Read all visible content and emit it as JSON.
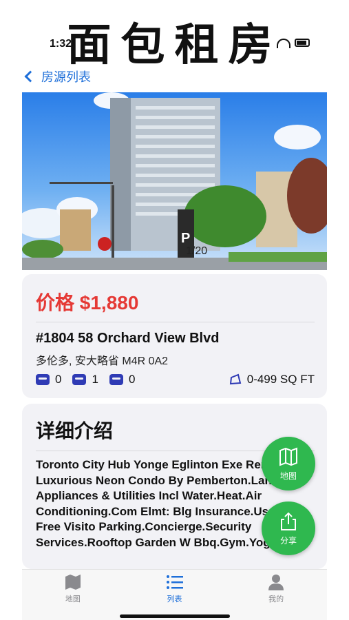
{
  "banner": {
    "title": "面包租房"
  },
  "status": {
    "time": "1:32"
  },
  "nav": {
    "back_label": "房源列表"
  },
  "photo": {
    "counter": "1/20"
  },
  "listing": {
    "price": "价格 $1,880",
    "address": "#1804  58 Orchard View Blvd",
    "region": "多伦多, 安大略省   M4R 0A2",
    "bedrooms": "0",
    "bathrooms": "1",
    "parking": "0",
    "area": "0-499  SQ FT"
  },
  "details": {
    "title": "详细介绍",
    "text": "Toronto City Hub Yonge Eglinton Exe Rental. Luxurious Neon Condo By Pemberton.Landlord Appliances & Utilities Incl Water.Heat.Air Conditioning.Com Elmt: Blg Insurance.Use Of Free Visito Parking.Concierge.Security Services.Rooftop Garden W Bbq.Gym.Yoga"
  },
  "fabs": {
    "map_label": "地图",
    "share_label": "分享"
  },
  "tabs": [
    {
      "label": "地图",
      "icon": "map-icon",
      "active": false
    },
    {
      "label": "列表",
      "icon": "list-icon",
      "active": true
    },
    {
      "label": "我的",
      "icon": "person-icon",
      "active": false
    }
  ],
  "colors": {
    "accent": "#1e6fd9",
    "price": "#e53935",
    "fab": "#2fb84f",
    "amenity_icon": "#2f3bb5"
  }
}
